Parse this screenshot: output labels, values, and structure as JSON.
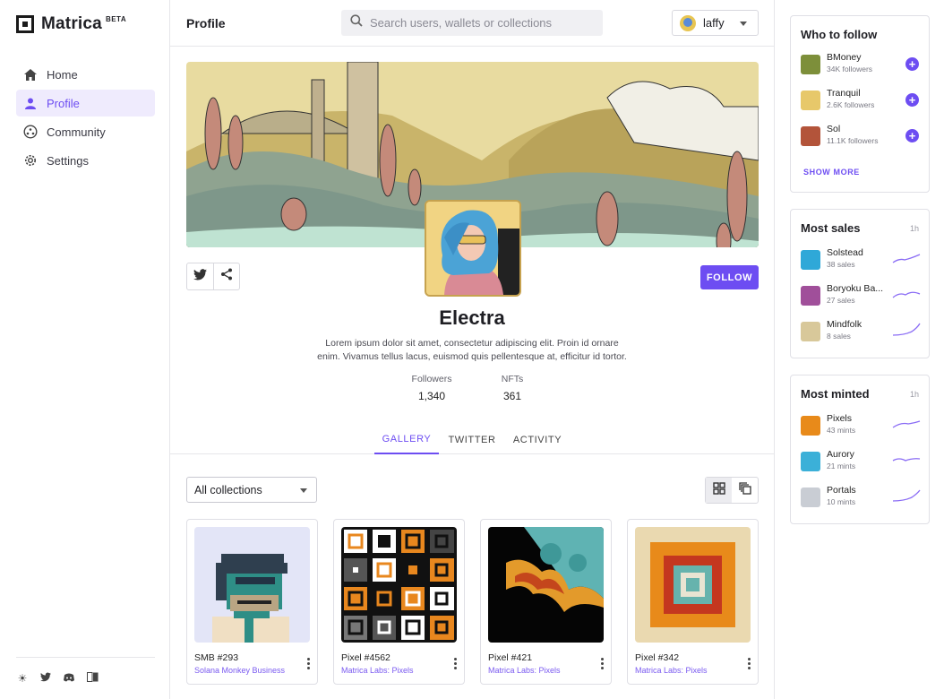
{
  "brand": {
    "name": "Matrica",
    "badge": "BETA"
  },
  "sidebar": {
    "items": [
      {
        "label": "Home",
        "icon": "home-icon"
      },
      {
        "label": "Profile",
        "icon": "person-icon",
        "active": true
      },
      {
        "label": "Community",
        "icon": "community-icon"
      },
      {
        "label": "Settings",
        "icon": "gear-icon"
      }
    ],
    "footer_icons": [
      "sun-icon",
      "twitter-icon",
      "discord-icon",
      "docs-icon"
    ]
  },
  "header": {
    "title": "Profile",
    "search_placeholder": "Search users, wallets or collections",
    "user_name": "laffy"
  },
  "profile": {
    "name": "Electra",
    "bio": "Lorem ipsum dolor sit amet, consectetur adipiscing elit. Proin id ornare enim. Vivamus tellus lacus, euismod quis pellentesque at, efficitur id tortor.",
    "follow_label": "FOLLOW",
    "stats": [
      {
        "label": "Followers",
        "value": "1,340"
      },
      {
        "label": "NFTs",
        "value": "361"
      }
    ]
  },
  "tabs": [
    {
      "label": "GALLERY",
      "active": true
    },
    {
      "label": "TWITTER"
    },
    {
      "label": "ACTIVITY"
    }
  ],
  "gallery": {
    "filter_value": "All collections",
    "items": [
      {
        "title": "SMB #293",
        "collection": "Solana Monkey Business"
      },
      {
        "title": "Pixel #4562",
        "collection": "Matrica Labs: Pixels"
      },
      {
        "title": "Pixel #421",
        "collection": "Matrica Labs: Pixels"
      },
      {
        "title": "Pixel #342",
        "collection": "Matrica Labs: Pixels"
      }
    ]
  },
  "who_to_follow": {
    "title": "Who to follow",
    "show_more": "SHOW MORE",
    "items": [
      {
        "name": "BMoney",
        "sub": "34K followers"
      },
      {
        "name": "Tranquil",
        "sub": "2.6K followers"
      },
      {
        "name": "Sol",
        "sub": "11.1K followers"
      }
    ]
  },
  "most_sales": {
    "title": "Most sales",
    "period": "1h",
    "items": [
      {
        "name": "Solstead",
        "sub": "38 sales"
      },
      {
        "name": "Boryoku Ba...",
        "sub": "27 sales"
      },
      {
        "name": "Mindfolk",
        "sub": "8 sales"
      }
    ]
  },
  "most_minted": {
    "title": "Most minted",
    "period": "1h",
    "items": [
      {
        "name": "Pixels",
        "sub": "43 mints"
      },
      {
        "name": "Aurory",
        "sub": "21 mints"
      },
      {
        "name": "Portals",
        "sub": "10 mints"
      }
    ]
  },
  "colors": {
    "accent": "#6d4df2",
    "active_bg": "#efebfd"
  }
}
